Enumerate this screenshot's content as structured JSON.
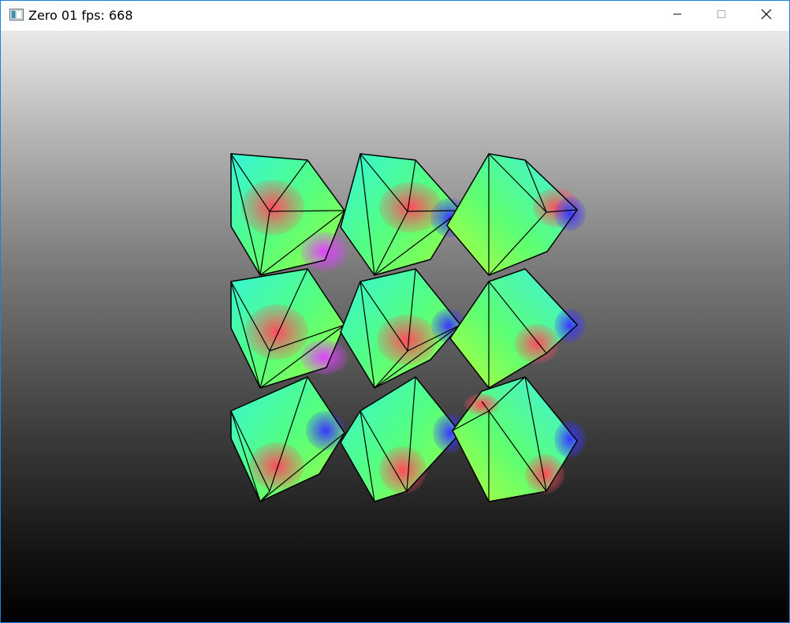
{
  "window": {
    "title": "Zero 01 fps: 668",
    "icon": "app-window-icon",
    "controls": {
      "minimize_icon": "minimize-icon",
      "maximize_icon": "maximize-icon",
      "close_icon": "close-icon"
    }
  },
  "scene": {
    "background_top": "#e8e8e8",
    "background_bottom": "#000000",
    "object": "rotating-cubes",
    "grid": "3x3",
    "edge_color": "#000000"
  }
}
